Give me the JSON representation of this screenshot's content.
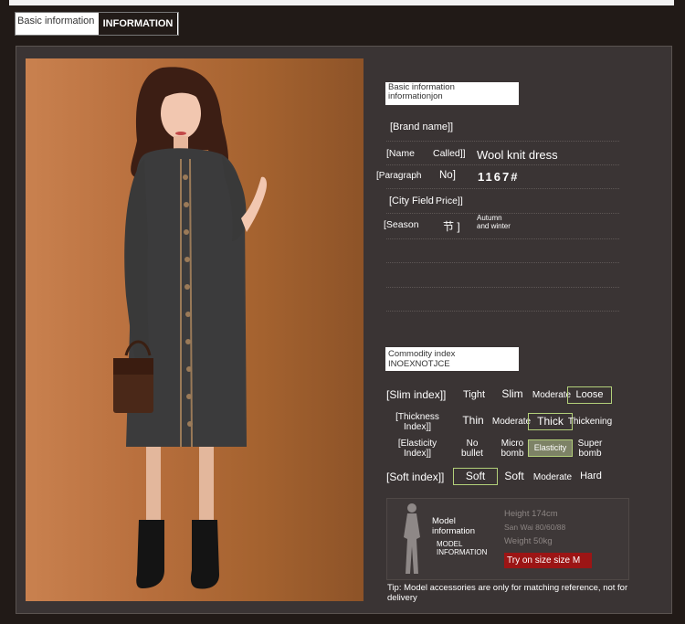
{
  "tabs": {
    "basic": "Basic information",
    "info": "INFORMATION"
  },
  "info_header": {
    "line1": "Basic information",
    "line2": "informationjon"
  },
  "rows": {
    "brand": "[Brand name]]",
    "name_label_a": "[Name",
    "name_label_b": "Called]]",
    "name_value": "Wool knit dress",
    "para_label_a": "[Paragraph",
    "para_label_b": "No]",
    "para_value": "1167#",
    "city_label_a": "[City Field",
    "city_label_b": "Price]]",
    "season_label_a": "[Season",
    "season_label_b": "节 ]",
    "season_value": "Autumn and winter"
  },
  "commodity_header": "Commodity index INOEXNOTJCE",
  "indices": {
    "slim": {
      "label": "[Slim index]]",
      "options": [
        "Tight",
        "Slim",
        "Moderate",
        "Loose"
      ],
      "selected": "Loose"
    },
    "thickness": {
      "label": "[Thickness Index]]",
      "options": [
        "Thin",
        "Moderate",
        "Thick",
        "Thickening"
      ],
      "selected": "Thick"
    },
    "elasticity": {
      "label": "[Elasticity Index]]",
      "options": [
        "No bullet",
        "Micro bomb",
        "Elasticity",
        "Super bomb"
      ],
      "selected": "Elasticity"
    },
    "soft": {
      "label": "[Soft index]]",
      "options": [
        "Soft",
        "Soft",
        "Moderate",
        "Hard"
      ],
      "selected": "Soft"
    }
  },
  "model": {
    "title_a": "Model",
    "title_b": "information",
    "title_c": "MODEL",
    "title_d": "INFORMATION",
    "height": "Height 174cm",
    "sanwai": "San Wai 80/60/88",
    "weight": "Weight 50kg",
    "tryon": "Try on size size M"
  },
  "tip": "Tip: Model accessories are only for matching reference, not for delivery",
  "colors": {
    "accent_red": "#9c1515",
    "selected_border": "#b3d07a",
    "panel": "#3a3434",
    "background": "#211a17"
  }
}
